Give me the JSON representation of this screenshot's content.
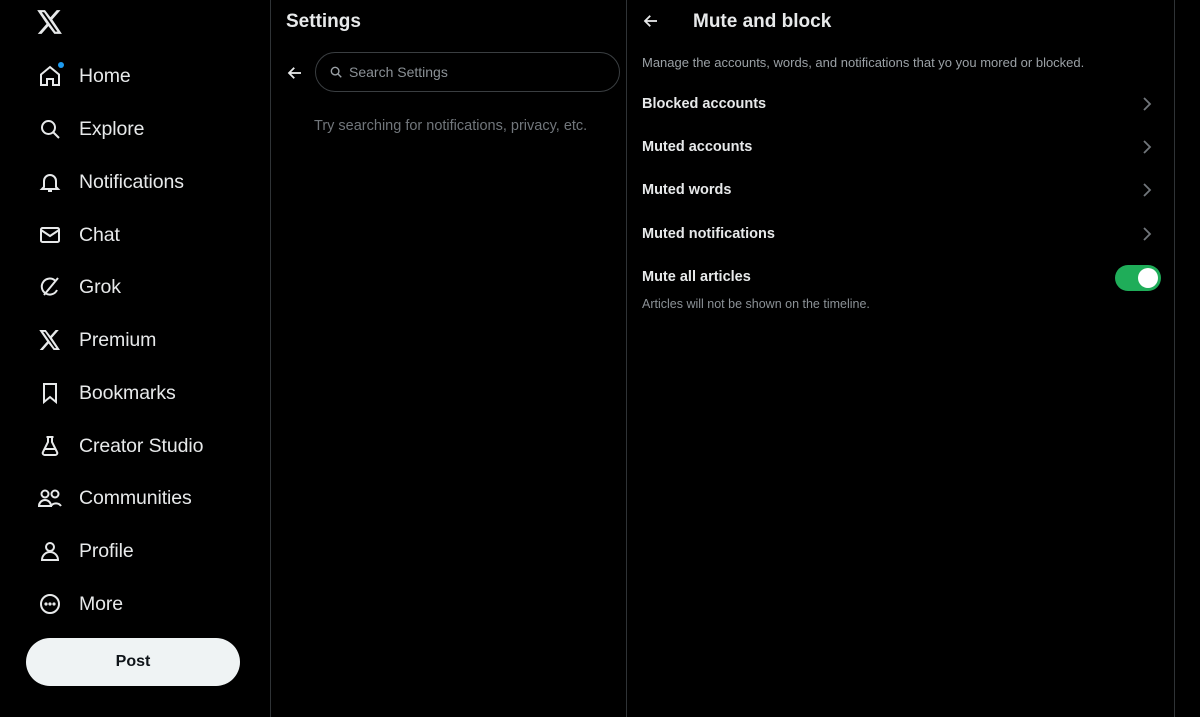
{
  "nav": {
    "items": [
      {
        "label": "Home",
        "icon": "home-icon"
      },
      {
        "label": "Explore",
        "icon": "search-icon"
      },
      {
        "label": "Notifications",
        "icon": "bell-icon"
      },
      {
        "label": "Chat",
        "icon": "envelope-icon"
      },
      {
        "label": "Grok",
        "icon": "grok-icon"
      },
      {
        "label": "Premium",
        "icon": "x-logo-icon"
      },
      {
        "label": "Bookmarks",
        "icon": "bookmark-icon"
      },
      {
        "label": "Creator Studio",
        "icon": "flask-icon"
      },
      {
        "label": "Communities",
        "icon": "people-icon"
      },
      {
        "label": "Profile",
        "icon": "person-icon"
      },
      {
        "label": "More",
        "icon": "more-circle-icon"
      }
    ],
    "post_label": "Post"
  },
  "settings": {
    "title": "Settings",
    "search_placeholder": "Search Settings",
    "search_hint": "Try searching for notifications, privacy, etc."
  },
  "detail": {
    "title": "Mute and block",
    "description": "Manage the accounts, words, and notifications that yo you mored or blocked.",
    "rows": [
      {
        "label": "Blocked accounts"
      },
      {
        "label": "Muted accounts"
      },
      {
        "label": "Muted words"
      },
      {
        "label": "Muted notifications"
      }
    ],
    "toggle": {
      "label": "Mute all articles",
      "sublabel": "Articles will not be shown on the timeline.",
      "enabled": true
    }
  },
  "colors": {
    "background": "#000000",
    "text": "#e7e9ea",
    "muted_text": "#71767b",
    "accent": "#1d9bf0",
    "toggle_on": "#1fad59",
    "post_button": "#eff3f4"
  }
}
